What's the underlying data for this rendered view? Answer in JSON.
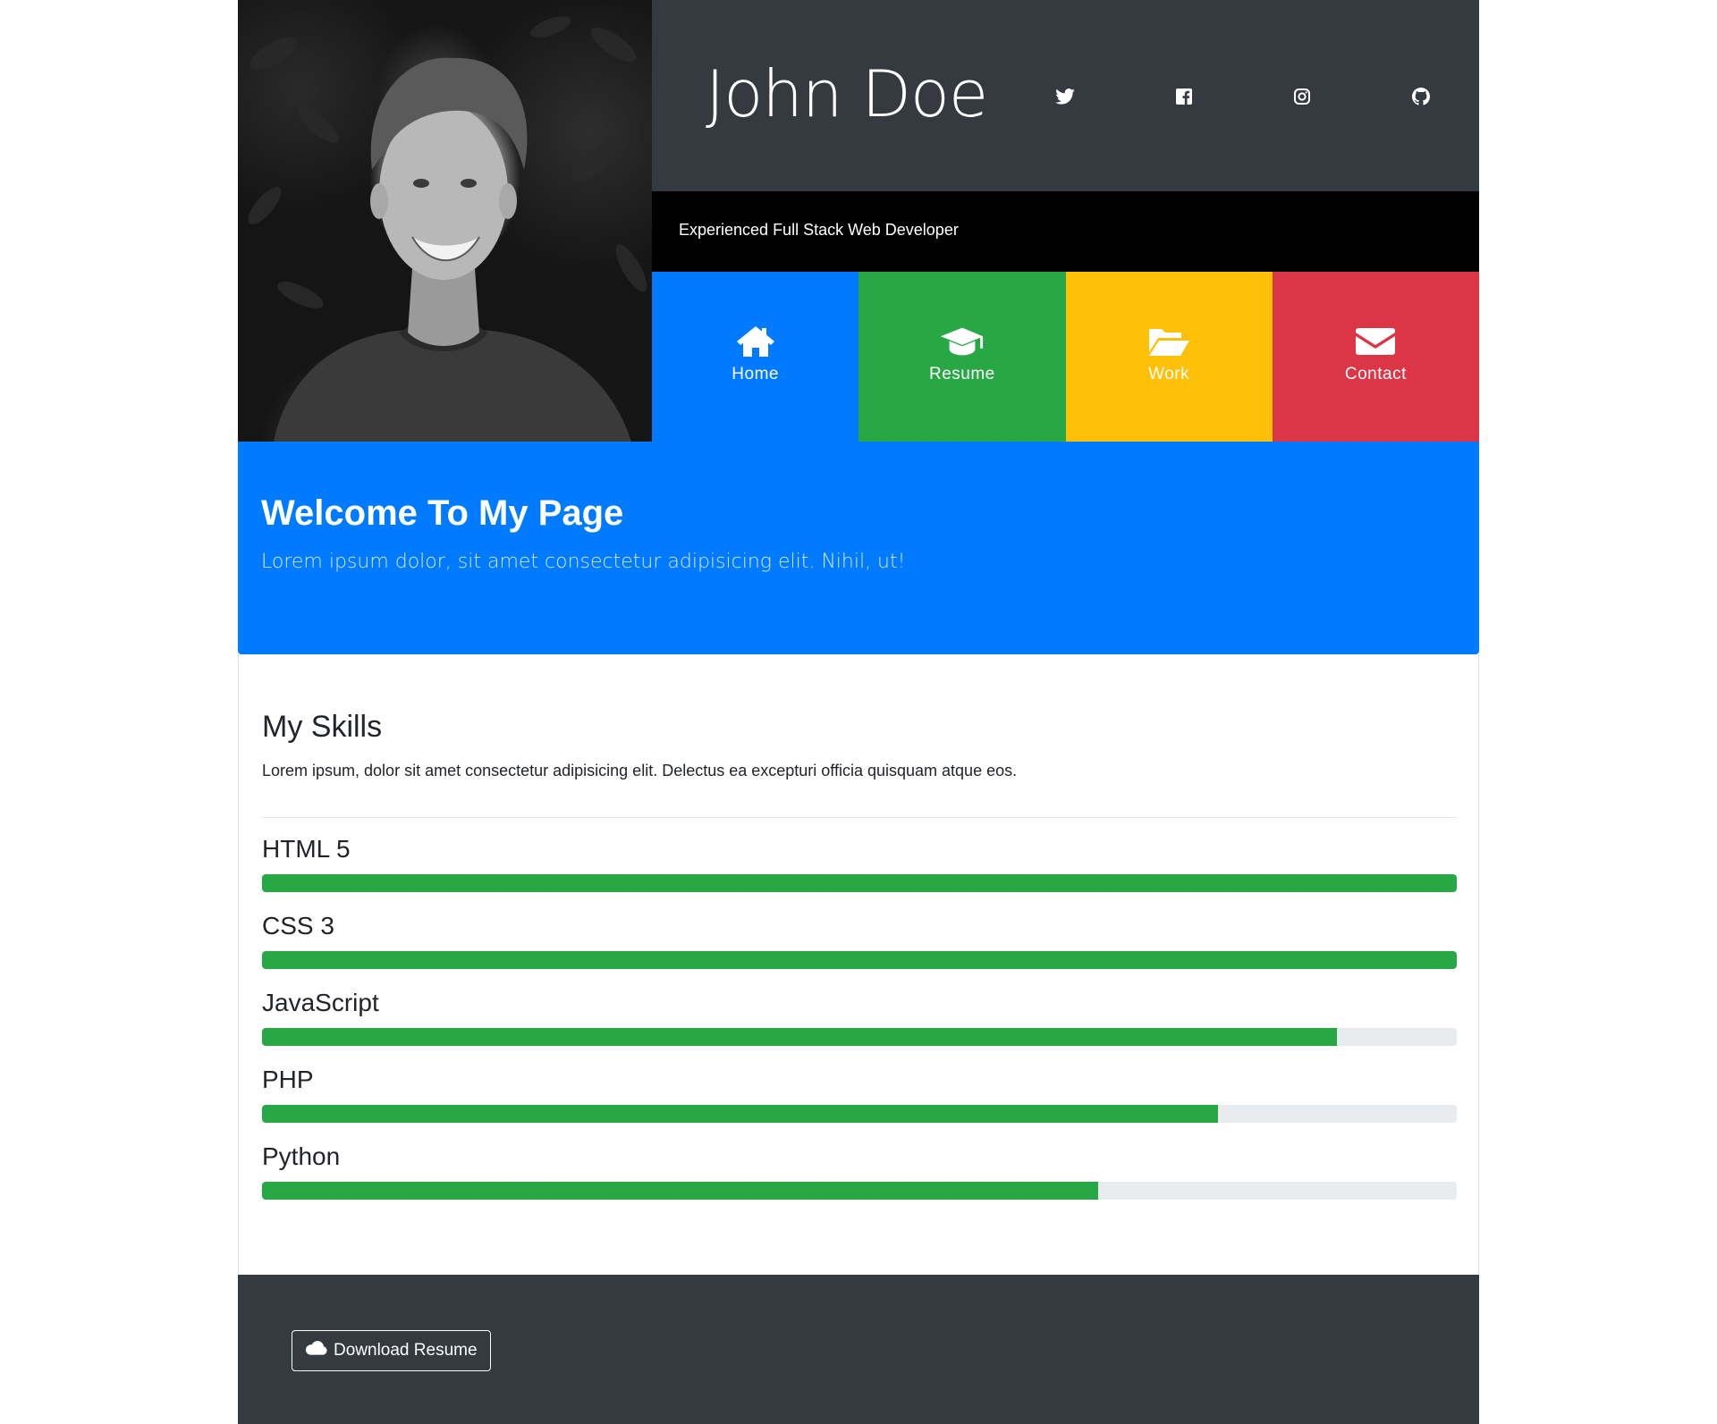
{
  "header": {
    "name": "John Doe",
    "tagline": "Experienced Full Stack Web Developer",
    "photo_icon": "profile-photo",
    "social": [
      {
        "icon": "twitter-icon"
      },
      {
        "icon": "facebook-icon"
      },
      {
        "icon": "instagram-icon"
      },
      {
        "icon": "github-icon"
      }
    ]
  },
  "nav": [
    {
      "label": "Home",
      "icon": "home-icon",
      "color": "#007bff"
    },
    {
      "label": "Resume",
      "icon": "graduation-cap-icon",
      "color": "#28a745"
    },
    {
      "label": "Work",
      "icon": "folder-open-icon",
      "color": "#ffc107"
    },
    {
      "label": "Contact",
      "icon": "envelope-icon",
      "color": "#dc3545"
    }
  ],
  "welcome": {
    "title": "Welcome To My Page",
    "lead": "Lorem ipsum dolor, sit amet consectetur adipisicing elit. Nihil, ut!"
  },
  "skills": {
    "title": "My Skills",
    "description": "Lorem ipsum, dolor sit amet consectetur adipisicing elit. Delectus ea excepturi officia quisquam atque eos.",
    "items": [
      {
        "name": "HTML 5",
        "percent": 100
      },
      {
        "name": "CSS 3",
        "percent": 100
      },
      {
        "name": "JavaScript",
        "percent": 90
      },
      {
        "name": "PHP",
        "percent": 80
      },
      {
        "name": "Python",
        "percent": 70
      }
    ]
  },
  "footer": {
    "download_label": "Download Resume",
    "download_icon": "cloud-icon"
  },
  "colors": {
    "dark": "#343a40",
    "black": "#000000",
    "primary": "#007bff",
    "success": "#28a745",
    "warning": "#ffc107",
    "danger": "#dc3545",
    "track": "#e9ecef"
  }
}
